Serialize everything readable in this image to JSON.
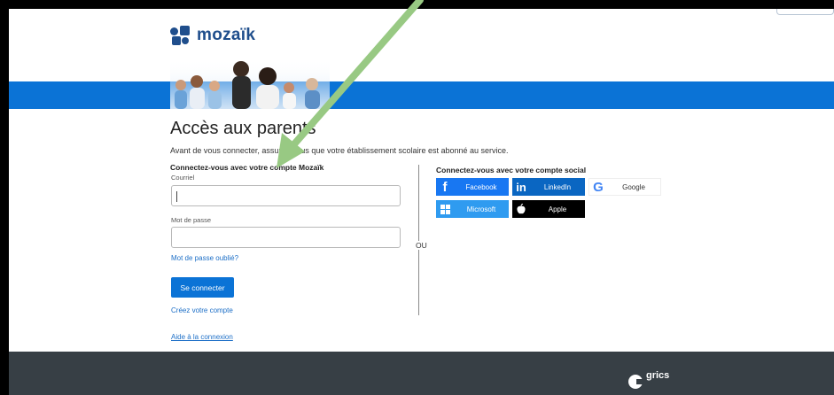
{
  "brand": {
    "name": "mozaïk",
    "color": "#1f4e8c"
  },
  "page": {
    "title": "Accès aux parents",
    "intro": "Avant de vous connecter, assurez-vous que votre établissement scolaire est abonné au service."
  },
  "login": {
    "heading": "Connectez-vous avec votre compte Mozaïk",
    "email_label": "Courriel",
    "password_label": "Mot de passe",
    "forgot_link": "Mot de passe oublié?",
    "submit_label": "Se connecter",
    "create_link": "Créez votre compte",
    "help_link": "Aide à la connexion"
  },
  "separator": "OU",
  "social": {
    "heading": "Connectez-vous avec votre compte social",
    "buttons": [
      {
        "label": "Facebook",
        "icon": "facebook-icon",
        "color": "#1877f2"
      },
      {
        "label": "LinkedIn",
        "icon": "linkedin-icon",
        "color": "#0a66c2"
      },
      {
        "label": "Google",
        "icon": "google-icon",
        "color": "#ffffff"
      },
      {
        "label": "Microsoft",
        "icon": "microsoft-icon",
        "color": "#2f9bf0"
      },
      {
        "label": "Apple",
        "icon": "apple-icon",
        "color": "#000000"
      }
    ]
  },
  "footer": {
    "brand": "grics"
  },
  "colors": {
    "banner": "#0b73d6",
    "footer": "#373f45",
    "arrow": "#98c983"
  }
}
